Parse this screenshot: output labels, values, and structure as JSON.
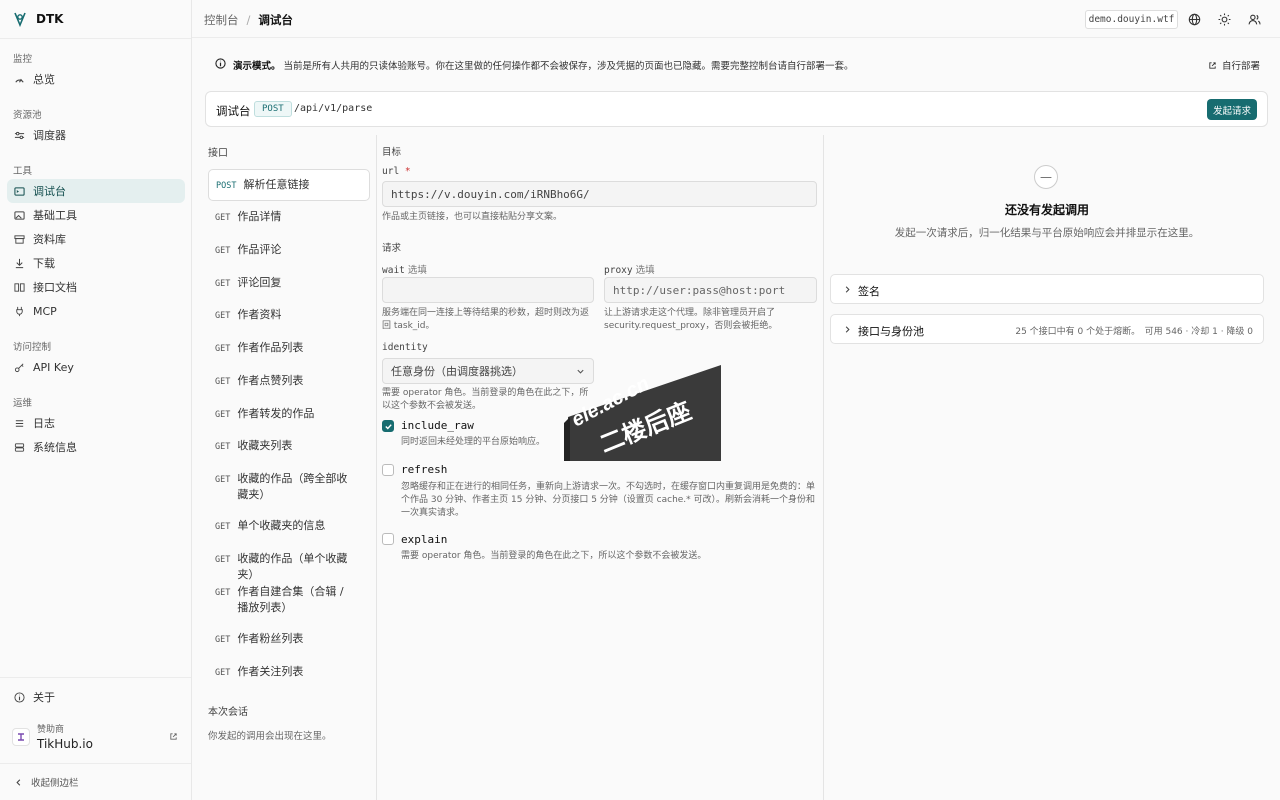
{
  "app": {
    "name": "DTK"
  },
  "sidebar": {
    "sections": [
      {
        "title": "监控",
        "items": [
          {
            "label": "总览",
            "icon": "gauge-icon"
          }
        ]
      },
      {
        "title": "资源池",
        "items": [
          {
            "label": "调度器",
            "icon": "sliders-icon"
          }
        ]
      },
      {
        "title": "工具",
        "items": [
          {
            "label": "调试台",
            "icon": "terminal-icon",
            "active": true
          },
          {
            "label": "基础工具",
            "icon": "image-icon"
          },
          {
            "label": "资料库",
            "icon": "archive-icon"
          },
          {
            "label": "下载",
            "icon": "download-icon"
          },
          {
            "label": "接口文档",
            "icon": "book-icon"
          },
          {
            "label": "MCP",
            "icon": "plug-icon"
          }
        ]
      },
      {
        "title": "访问控制",
        "items": [
          {
            "label": "API Key",
            "icon": "key-icon"
          }
        ]
      },
      {
        "title": "运维",
        "items": [
          {
            "label": "日志",
            "icon": "list-icon"
          },
          {
            "label": "系统信息",
            "icon": "server-icon"
          }
        ]
      }
    ],
    "about": "关于",
    "sponsor": {
      "label": "赞助商",
      "name": "TikHub.io"
    },
    "collapse": "收起侧边栏"
  },
  "topbar": {
    "breadcrumb": [
      "控制台",
      "调试台"
    ],
    "separator": "/",
    "domain": "demo.douyin.wtf"
  },
  "banner": {
    "bold": "演示模式。",
    "text": "当前是所有人共用的只读体验账号。你在这里做的任何操作都不会被保存，涉及凭据的页面也已隐藏。需要完整控制台请自行部署一套。",
    "link": "自行部署"
  },
  "console": {
    "title": "调试台",
    "method": "POST",
    "path": "/api/v1/parse",
    "send": "发起请求"
  },
  "endpoints": {
    "title": "接口",
    "items": [
      {
        "method": "POST",
        "label": "解析任意链接",
        "active": true
      },
      {
        "method": "GET",
        "label": "作品详情"
      },
      {
        "method": "GET",
        "label": "作品评论"
      },
      {
        "method": "GET",
        "label": "评论回复"
      },
      {
        "method": "GET",
        "label": "作者资料"
      },
      {
        "method": "GET",
        "label": "作者作品列表"
      },
      {
        "method": "GET",
        "label": "作者点赞列表"
      },
      {
        "method": "GET",
        "label": "作者转发的作品"
      },
      {
        "method": "GET",
        "label": "收藏夹列表"
      },
      {
        "method": "GET",
        "label": "收藏的作品（跨全部收藏夹）"
      },
      {
        "method": "GET",
        "label": "单个收藏夹的信息"
      },
      {
        "method": "GET",
        "label": "收藏的作品（单个收藏夹）"
      },
      {
        "method": "GET",
        "label": "作者自建合集（合辑 / 播放列表）"
      },
      {
        "method": "GET",
        "label": "作者粉丝列表"
      },
      {
        "method": "GET",
        "label": "作者关注列表"
      }
    ],
    "session_title": "本次会话",
    "session_empty": "你发起的调用会出现在这里。"
  },
  "form": {
    "target_title": "目标",
    "url": {
      "label": "url",
      "required": "*",
      "value": "https://v.douyin.com/iRNBho6G/",
      "help": "作品或主页链接，也可以直接粘贴分享文案。"
    },
    "request_title": "请求",
    "wait": {
      "label": "wait",
      "optional": "选填",
      "value": "",
      "help": "服务端在同一连接上等待结果的秒数，超时则改为返回 task_id。"
    },
    "proxy": {
      "label": "proxy",
      "optional": "选填",
      "placeholder": "http://user:pass@host:port",
      "help": "让上游请求走这个代理。除非管理员开启了 security.request_proxy，否则会被拒绝。"
    },
    "identity": {
      "label": "identity",
      "value": "任意身份（由调度器挑选）",
      "help": "需要 operator 角色。当前登录的角色在此之下，所以这个参数不会被发送。"
    },
    "include_raw": {
      "label": "include_raw",
      "checked": true,
      "help": "同时返回未经处理的平台原始响应。"
    },
    "refresh": {
      "label": "refresh",
      "checked": false,
      "help": "忽略缓存和正在进行的相同任务，重新向上游请求一次。不勾选时，在缓存窗口内重复调用是免费的：单个作品 30 分钟、作者主页 15 分钟、分页接口 5 分钟（设置页 cache.* 可改）。刷新会消耗一个身份和一次真实请求。"
    },
    "explain": {
      "label": "explain",
      "checked": false,
      "help": "需要 operator 角色。当前登录的角色在此之下，所以这个参数不会被发送。"
    }
  },
  "response": {
    "empty_icon": "—",
    "empty_title": "还没有发起调用",
    "empty_desc": "发起一次请求后，归一化结果与平台原始响应会并排显示在这里。",
    "signature": "签名",
    "pool": "接口与身份池",
    "pool_meta": "25 个接口中有 0 个处于熔断。　可用 546 · 冷却 1 · 降级 0"
  },
  "watermark": {
    "line1": "ele.ac.cn",
    "line2": "二楼后座"
  }
}
